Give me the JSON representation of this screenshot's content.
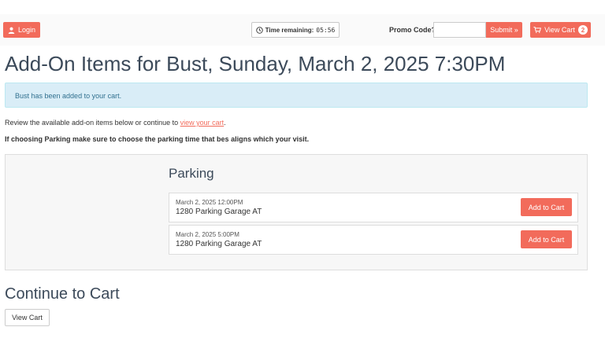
{
  "header": {
    "login_label": "Login",
    "timer_label": "Time remaining:",
    "timer_value": "05:56",
    "promo_label": "Promo Code?",
    "promo_value": "",
    "promo_placeholder": "",
    "submit_label": "Submit »",
    "view_cart_label": "View Cart",
    "cart_count": "2"
  },
  "page": {
    "title": "Add-On Items for Bust, Sunday, March 2, 2025 7:30PM",
    "alert": "Bust has been added to your cart.",
    "intro_text": "Review the available add-on items below or continue to ",
    "intro_link": "view your cart",
    "intro_end": ".",
    "notice": "If choosing Parking make sure to choose the parking time that bes aligns which your visit."
  },
  "addons": {
    "section_title": "Parking",
    "items": [
      {
        "date": "March 2, 2025 12:00PM",
        "location": "1280 Parking Garage AT",
        "button": "Add to Cart"
      },
      {
        "date": "March 2, 2025 5:00PM",
        "location": "1280 Parking Garage AT",
        "button": "Add to Cart"
      }
    ]
  },
  "footer": {
    "continue_title": "Continue to Cart",
    "view_cart_label": "View Cart"
  },
  "colors": {
    "accent": "#f26b5b",
    "heading": "#3c4a5a",
    "alert_bg": "#d9edf7",
    "alert_text": "#31708f"
  },
  "icons": {
    "login": "user-icon",
    "timer": "clock-icon",
    "cart": "shopping-cart-icon"
  }
}
